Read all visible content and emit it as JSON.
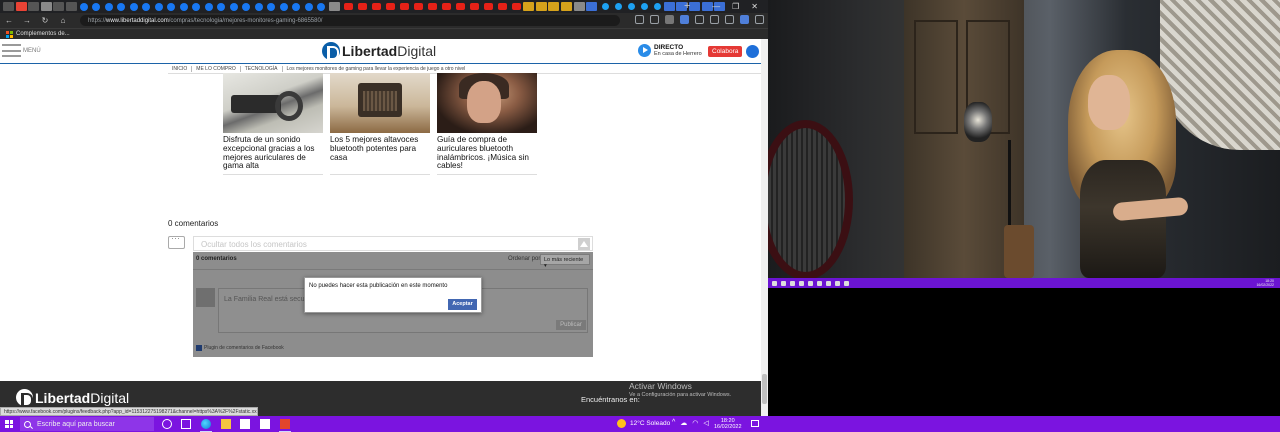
{
  "browser": {
    "url_prefix": "https://",
    "url_domain": "www.libertaddigital.com",
    "url_path": "/compras/tecnologia/mejores-monitores-gaming-6865580/",
    "bookmark": "Complementos de...",
    "status_url": "https://www.facebook.com/plugins/feedback.php?app_id=115312275198271&channel=https%3A%2F%2Fstatic.xx.fbc..."
  },
  "site": {
    "menu_label": "MENÚ",
    "logo_bold": "Libertad",
    "logo_normal": "Digital",
    "directo_title": "DIRECTO",
    "directo_sub": "En casa de Herrero",
    "colabora": "Colabora",
    "breadcrumb": [
      "INICIO",
      "ME LO COMPRO",
      "TECNOLOGÍA",
      "Los mejores monitores de gaming para llevar la experiencia de juego a otro nivel"
    ]
  },
  "articles": [
    {
      "title": "Disfruta de un sonido excepcional gracias a los mejores auriculares de gama alta"
    },
    {
      "title": "Los 5 mejores altavoces bluetooth potentes para casa"
    },
    {
      "title": "Guía de compra de auriculares bluetooth inalámbricos. ¡Música sin cables!"
    }
  ],
  "comments": {
    "count_label": "0 comentarios",
    "hide_label": "Ocultar todos los comentarios",
    "fb_count": "0 comentarios",
    "order_label": "Ordenar por",
    "order_value": "Lo más reciente ▾",
    "placeholder": "La Familia Real está secues",
    "post_button": "Publicar",
    "plugin_label": "Plugin de comentarios de Facebook"
  },
  "dialog": {
    "message": "No puedes hacer esta publicación en este momento",
    "accept": "Aceptar"
  },
  "footer": {
    "logo_bold": "Libertad",
    "logo_normal": "Digital",
    "find_us": "Encuéntranos en:",
    "activate_title": "Activar Windows",
    "activate_sub": "Ve a Configuración para activar Windows."
  },
  "taskbar": {
    "search_placeholder": "Escribe aquí para buscar",
    "weather": "12°C  Soleado",
    "time": "18:20",
    "date": "16/02/2022",
    "mini_time": "18:20",
    "mini_date": "16/02/2022"
  }
}
